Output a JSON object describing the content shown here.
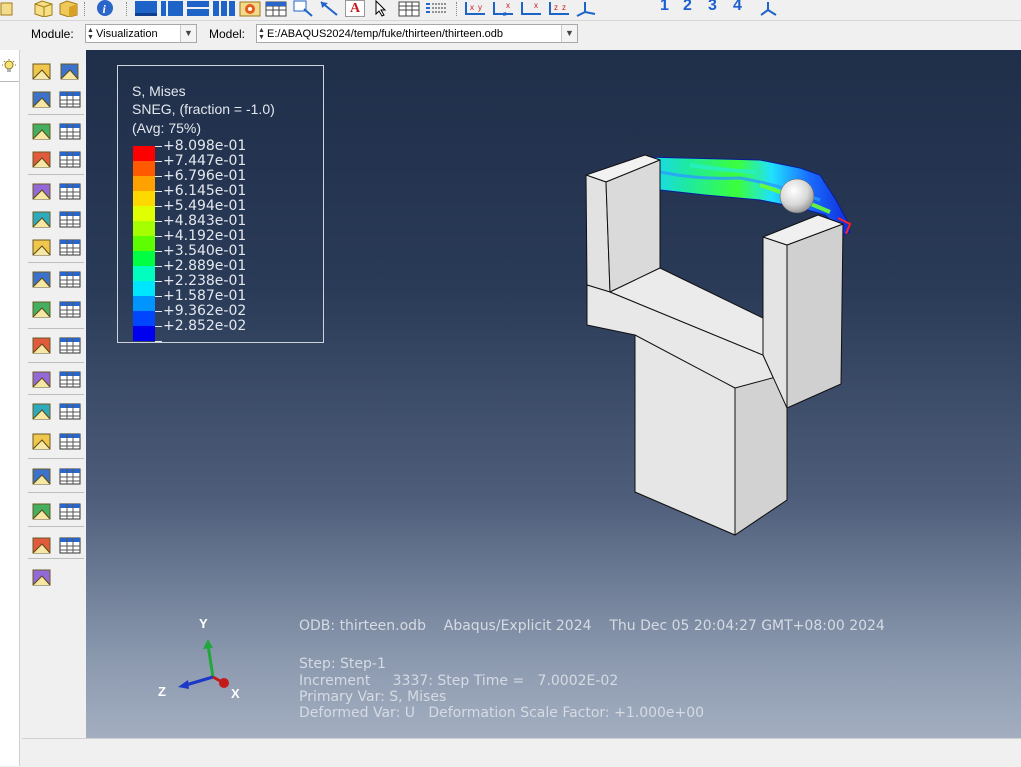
{
  "module_bar": {
    "module_label": "Module:",
    "module_value": "Visualization",
    "model_label": "Model:",
    "model_value": "E:/ABAQUS2024/temp/fuke/thirteen/thirteen.odb"
  },
  "toolbar": {
    "view_numbers": [
      "1",
      "2",
      "3",
      "4"
    ],
    "text_tool": "A"
  },
  "legend": {
    "title1": "S, Mises",
    "title2": "SNEG, (fraction = -1.0)",
    "title3": "(Avg: 75%)",
    "values": [
      "+8.098e-01",
      "+7.447e-01",
      "+6.796e-01",
      "+6.145e-01",
      "+5.494e-01",
      "+4.843e-01",
      "+4.192e-01",
      "+3.540e-01",
      "+2.889e-01",
      "+2.238e-01",
      "+1.587e-01",
      "+9.362e-02",
      "+2.852e-02"
    ],
    "colors": [
      "#ff0000",
      "#ff5a00",
      "#ffa100",
      "#ffd800",
      "#e0ff00",
      "#a6ff00",
      "#5dff00",
      "#00ff43",
      "#00ffbf",
      "#00e6ff",
      "#0094ff",
      "#0046ff",
      "#0000ee"
    ]
  },
  "info": {
    "odb": "ODB: thirteen.odb    Abaqus/Explicit 2024    Thu Dec 05 20:04:27 GMT+08:00 2024",
    "step": "Step: Step-1",
    "increment": "Increment     3337: Step Time =   7.0002E-02",
    "primary_var": "Primary Var: S, Mises",
    "deformed_var": "Deformed Var: U   Deformation Scale Factor: +1.000e+00"
  },
  "triad": {
    "x": "X",
    "y": "Y",
    "z": "Z"
  },
  "colors": {
    "viewport_top": "#1f2e49",
    "viewport_bottom": "#a3aec0",
    "part_face": "#e6e6e6",
    "part_edge": "#111111"
  }
}
